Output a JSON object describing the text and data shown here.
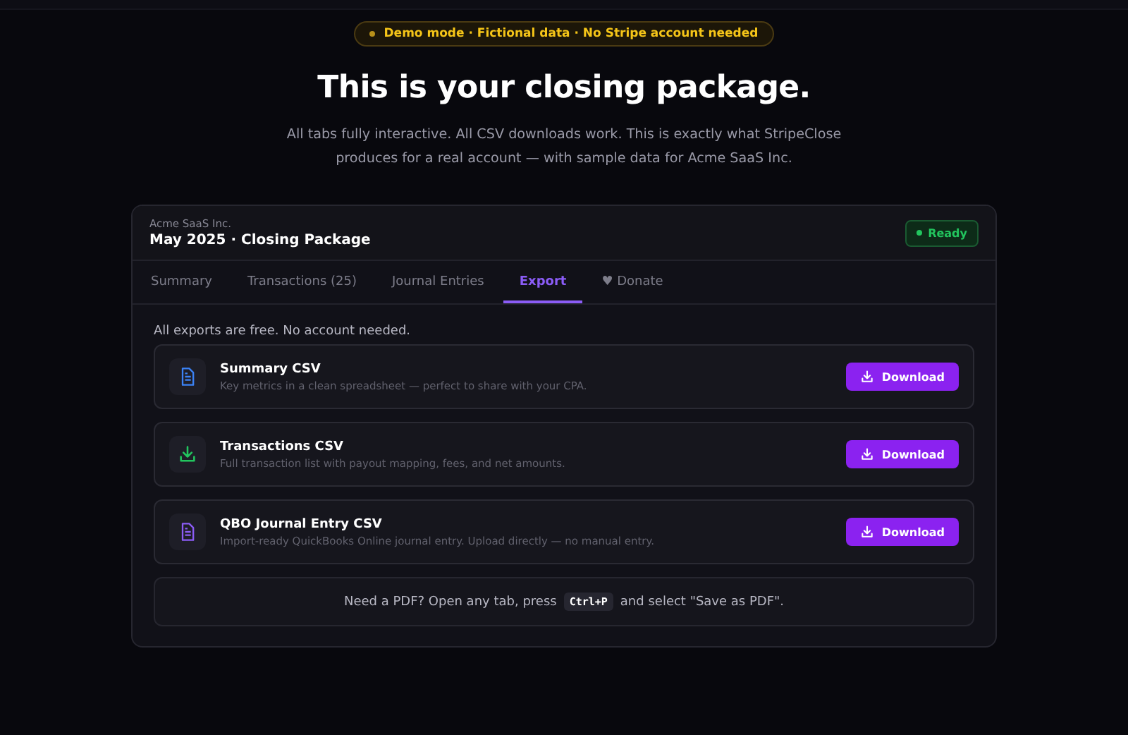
{
  "banner": {
    "text": "Demo mode · Fictional data · No Stripe account needed"
  },
  "heading": "This is your closing package.",
  "intro": "All tabs fully interactive. All CSV downloads work. This is exactly what StripeClose produces for a real account — with sample data for Acme SaaS Inc.",
  "package": {
    "company": "Acme SaaS Inc.",
    "title": "May 2025 · Closing Package",
    "status": "Ready",
    "tabs": [
      {
        "label": "Summary",
        "selected": false
      },
      {
        "label": "Transactions (25)",
        "selected": false
      },
      {
        "label": "Journal Entries",
        "selected": false
      },
      {
        "label": "Export",
        "selected": true
      },
      {
        "label": "♥ Donate",
        "selected": false
      }
    ],
    "note": "All exports are free. No account needed.",
    "exports": [
      {
        "kind": "document",
        "color": "#3b82f6",
        "title": "Summary CSV",
        "description": "Key metrics in a clean spreadsheet — perfect to share with your CPA.",
        "button": "Download"
      },
      {
        "kind": "download",
        "color": "#22c55e",
        "title": "Transactions CSV",
        "description": "Full transaction list with payout mapping, fees, and net amounts.",
        "button": "Download"
      },
      {
        "kind": "document",
        "color": "#8b5cf6",
        "title": "QBO Journal Entry CSV",
        "description": "Import-ready QuickBooks Online journal entry. Upload directly — no manual entry.",
        "button": "Download"
      }
    ],
    "pdf_tip": {
      "before": "Need a PDF? Open any tab, press",
      "key": "Ctrl+P",
      "after": "and select \"Save as PDF\"."
    }
  }
}
